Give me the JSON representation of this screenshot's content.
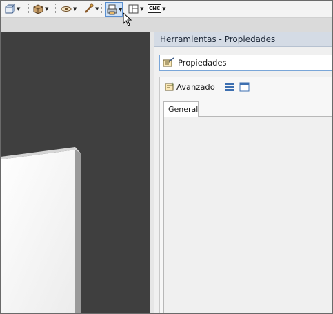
{
  "toolbar": {
    "buttons": [
      {
        "name": "view-cube-icon",
        "dropdown": true
      },
      {
        "name": "box-icon",
        "dropdown": true
      },
      {
        "name": "eye-icon",
        "dropdown": true
      },
      {
        "name": "brush-icon",
        "dropdown": true
      },
      {
        "name": "printer-icon",
        "dropdown": true,
        "active": true
      },
      {
        "name": "layout-icon",
        "dropdown": true
      },
      {
        "name": "cnc-icon",
        "label": "CNC",
        "dropdown": true
      }
    ]
  },
  "panel": {
    "title": "Herramientas - Propiedades",
    "selector_label": "Propiedades",
    "advanced_label": "Avanzado",
    "tabs": [
      {
        "label": "General",
        "selected": true
      }
    ]
  },
  "colors": {
    "viewport_bg": "#3f3f3f",
    "panel_header_bg": "#d4dbe5",
    "accent_border": "#7aa6d8"
  }
}
